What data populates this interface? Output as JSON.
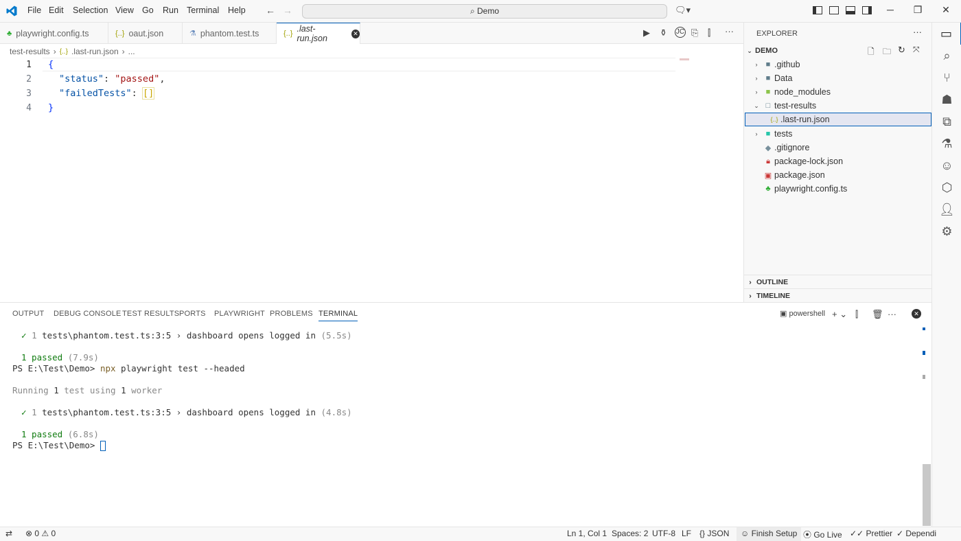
{
  "menu": [
    "File",
    "Edit",
    "Selection",
    "View",
    "Go",
    "Run",
    "Terminal",
    "Help"
  ],
  "search": {
    "label": "Demo"
  },
  "tabs": [
    {
      "label": "playwright.config.ts",
      "icon": "playwright-icon"
    },
    {
      "label": "oaut.json",
      "icon": "json-icon"
    },
    {
      "label": "phantom.test.ts",
      "icon": "flask-icon"
    },
    {
      "label": ".last-run.json",
      "icon": "json-icon",
      "active": true
    }
  ],
  "breadcrumb": {
    "folder": "test-results",
    "file": ".last-run.json",
    "more": "..."
  },
  "editor": {
    "line_numbers": [
      "1",
      "2",
      "3",
      "4"
    ],
    "lines": [
      {
        "open": "{"
      },
      {
        "key": "\"status\"",
        "colon": ": ",
        "value": "\"passed\"",
        "comma": ","
      },
      {
        "key": "\"failedTests\"",
        "colon": ": ",
        "value": "[]"
      },
      {
        "close": "}"
      }
    ]
  },
  "explorer": {
    "title": "EXPLORER",
    "root": "DEMO",
    "items": [
      {
        "label": ".github",
        "type": "folder"
      },
      {
        "label": "Data",
        "type": "folder"
      },
      {
        "label": "node_modules",
        "type": "folder"
      },
      {
        "label": "test-results",
        "type": "folder-open"
      },
      {
        "label": ".last-run.json",
        "type": "file"
      },
      {
        "label": "tests",
        "type": "folder"
      },
      {
        "label": ".gitignore",
        "type": "file"
      },
      {
        "label": "package-lock.json",
        "type": "file"
      },
      {
        "label": "package.json",
        "type": "file"
      },
      {
        "label": "playwright.config.ts",
        "type": "file"
      }
    ],
    "sections": [
      "OUTLINE",
      "TIMELINE"
    ]
  },
  "panel": {
    "tabs": [
      "OUTPUT",
      "DEBUG CONSOLE",
      "TEST RESULTS",
      "PORTS",
      "PLAYWRIGHT",
      "PROBLEMS",
      "TERMINAL"
    ],
    "shell": "powershell",
    "terminal": {
      "r1_check": "✓",
      "r1_num": "1",
      "r1_text": " tests\\phantom.test.ts:3:5 › dashboard opens logged in ",
      "r1_time": "(5.5s)",
      "r2_passed": "1 passed",
      "r2_time": " (7.9s)",
      "r3_prompt": "PS E:\\Test\\Demo> ",
      "r3_cmd": "npx",
      "r3_args": " playwright test --headed",
      "r4_a": "Running ",
      "r4_n1": "1",
      "r4_b": " test using ",
      "r4_n2": "1",
      "r4_c": " worker",
      "r5_check": "✓",
      "r5_num": "1",
      "r5_text": " tests\\phantom.test.ts:3:5 › dashboard opens logged in ",
      "r5_time": "(4.8s)",
      "r6_passed": "1 passed",
      "r6_time": " (6.8s)",
      "r7_prompt": "PS E:\\Test\\Demo> "
    }
  },
  "status": {
    "errors": "0",
    "warnings": "0",
    "position": "Ln 1, Col 1",
    "spaces": "Spaces: 2",
    "encoding": "UTF-8",
    "eol": "LF",
    "language": "JSON",
    "finish_setup": "Finish Setup",
    "go_live": "Go Live",
    "prettier": "Prettier",
    "dependi": "Dependi"
  }
}
